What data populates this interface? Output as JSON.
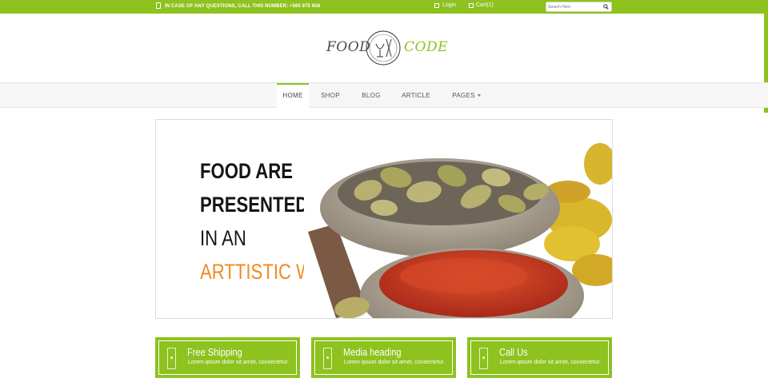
{
  "topbar": {
    "phone_text": "IN CASE OF ANY QUESTIONS, CALL THIS NUMBER: +565 975 658",
    "login_label": "Login",
    "cart_label": "Cart(1)",
    "search_placeholder": "Search Here"
  },
  "logo": {
    "left_word": "FOOD",
    "right_word": "CODE"
  },
  "nav": {
    "items": [
      {
        "label": "HOME",
        "active": true
      },
      {
        "label": "SHOP"
      },
      {
        "label": "BLOG"
      },
      {
        "label": "ARTICLE"
      },
      {
        "label": "PAGES"
      }
    ]
  },
  "hero": {
    "line1": "FOOD ARE",
    "line2": "PRESENTED",
    "line3": "IN AN",
    "line4": "ARTTISTIC WAY"
  },
  "features": [
    {
      "title": "Free Shipping",
      "desc": "Lorem ipsum dolor sit amet, consectetur."
    },
    {
      "title": "Media heading",
      "desc": "Lorem ipsum dolor sit amet, consectetur."
    },
    {
      "title": "Call Us",
      "desc": "Lorem ipsum dolor sit amet, consectetur."
    }
  ],
  "colors": {
    "accent": "#8dc21f",
    "highlight": "#f08a25",
    "text_dark": "#151515"
  },
  "icons": [
    "phone-icon",
    "login-icon",
    "cart-icon",
    "search-icon",
    "logo-emblem-icon",
    "feature-icon"
  ]
}
